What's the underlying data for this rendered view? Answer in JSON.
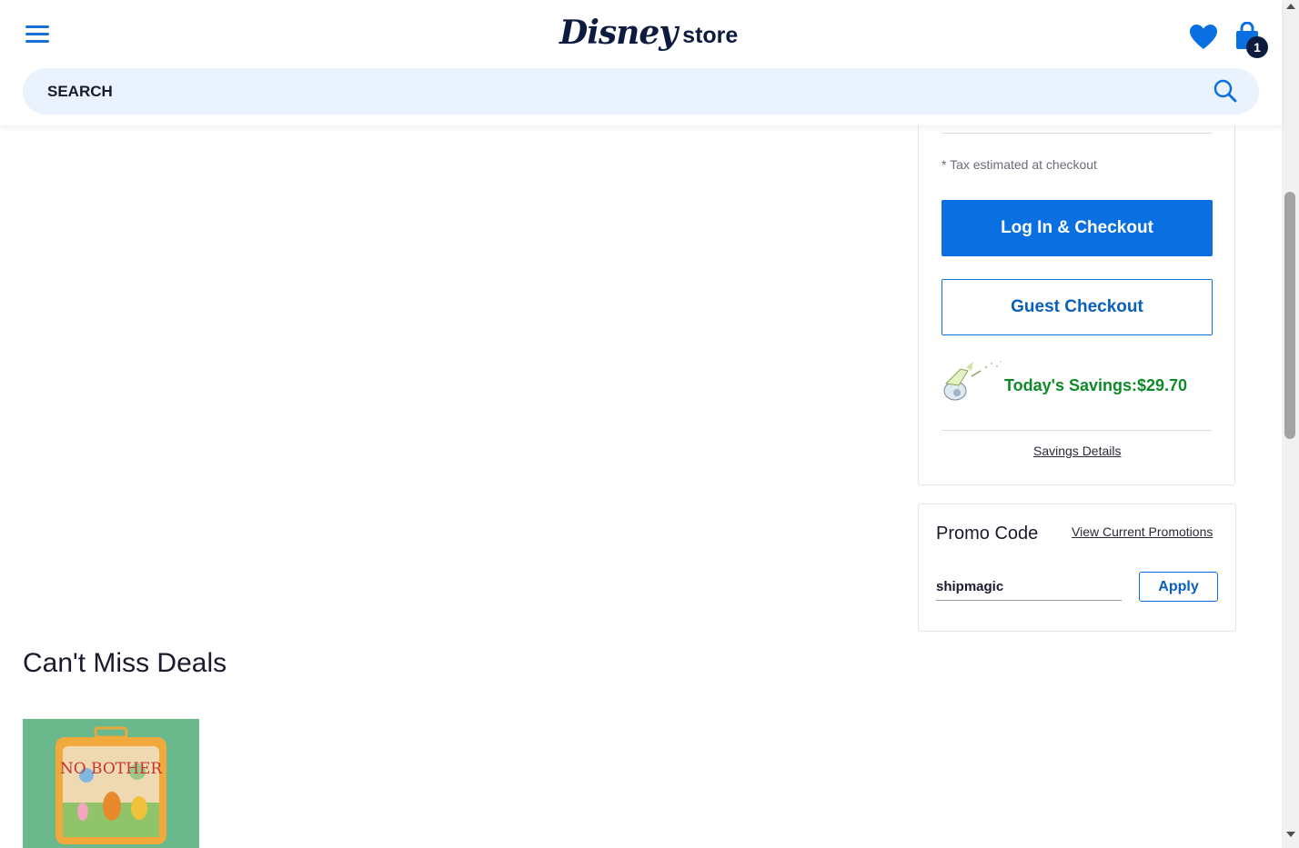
{
  "header": {
    "logo_disney": "Disney",
    "logo_store": "store",
    "cart_count": "1"
  },
  "search": {
    "placeholder": "SEARCH"
  },
  "order_summary": {
    "tax_note": "* Tax estimated at checkout",
    "login_checkout_label": "Log In & Checkout",
    "guest_checkout_label": "Guest Checkout",
    "savings_label": "Today's Savings:",
    "savings_value": "$29.70",
    "savings_details_link": "Savings Details"
  },
  "promo": {
    "title": "Promo Code",
    "view_promotions_link": "View Current Promotions",
    "code_value": "shipmagic",
    "apply_label": "Apply"
  },
  "deals": {
    "title": "Can't Miss Deals",
    "product_image_text": "NO BOTHER"
  },
  "colors": {
    "primary_blue": "#0a6fe0",
    "savings_green": "#0f8a28",
    "search_bg": "#e9f2fd",
    "navy": "#0d1b3e"
  }
}
